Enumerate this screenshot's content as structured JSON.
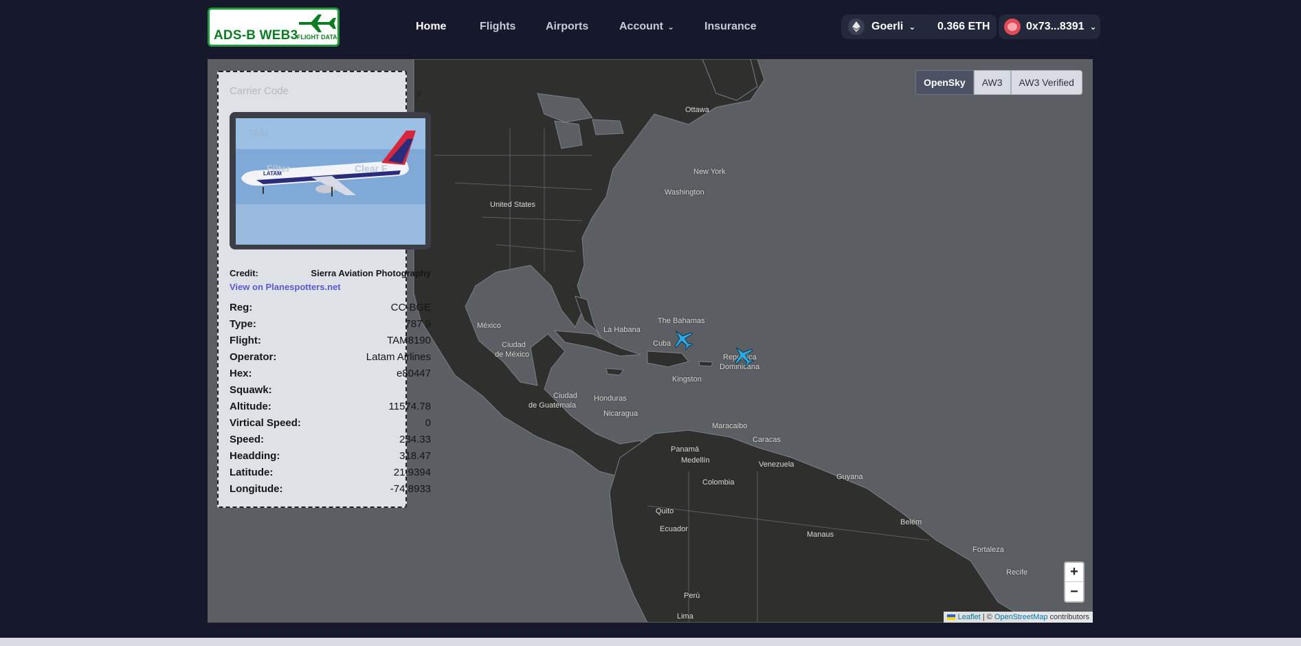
{
  "header": {
    "logo_text": "ADS-B WEB3",
    "logo_sub": "FLIGHT DATA",
    "nav": [
      {
        "label": "Home",
        "active": true
      },
      {
        "label": "Flights",
        "active": false
      },
      {
        "label": "Airports",
        "active": false
      },
      {
        "label": "Account",
        "active": false
      },
      {
        "label": "Insurance",
        "active": false
      }
    ],
    "network": "Goerli",
    "balance": "0.366 ETH",
    "account": "0x73...8391"
  },
  "map": {
    "layers": [
      {
        "label": "OpenSky",
        "active": true
      },
      {
        "label": "AW3",
        "active": false
      },
      {
        "label": "AW3 Verified",
        "active": false
      }
    ],
    "labels": {
      "ottawa": "Ottawa",
      "new_york": "New York",
      "washington": "Washington",
      "united_states": "United States",
      "mexico": "México",
      "ciudad_de_mexico_1": "Ciudad",
      "ciudad_de_mexico_2": "de México",
      "la_habana": "La Habana",
      "bahamas": "The Bahamas",
      "cuba": "Cuba",
      "republica": "República",
      "dominicana": "Dominicana",
      "kingston": "Kingston",
      "guatemala_1": "Ciudad",
      "guatemala_2": "de Guatemala",
      "honduras": "Honduras",
      "nicaragua": "Nicaragua",
      "panama": "Panamá",
      "maracaibo": "Maracaibo",
      "caracas": "Caracas",
      "medellin": "Medellín",
      "venezuela": "Venezuela",
      "guyana": "Guyana",
      "colombia": "Colombia",
      "quito": "Quito",
      "ecuador": "Ecuador",
      "belem": "Belém",
      "manaus": "Manaus",
      "fortaleza": "Fortaleza",
      "recife": "Recife",
      "peru": "Perú",
      "lima": "Lima"
    },
    "zoom_in": "+",
    "zoom_out": "−",
    "attribution": {
      "leaflet": "Leaflet",
      "sep": " | © ",
      "osm": "OpenStreetMap",
      "contributors": " contributors"
    }
  },
  "panel": {
    "ghost_carrier_label": "Carrier Code",
    "ghost_carrier_value": "TAM",
    "ghost_filter": "Filter",
    "ghost_clear": "Clear F",
    "close": "×",
    "credit_label": "Credit:",
    "credit_value": "Sierra Aviation Photography",
    "planespotters_link": "View on Planespotters.net",
    "fields": [
      {
        "label": "Reg:",
        "value": "CC-BGE"
      },
      {
        "label": "Type:",
        "value": "787 9"
      },
      {
        "label": "Flight:",
        "value": "TAM8190"
      },
      {
        "label": "Operator:",
        "value": "Latam Airlines"
      },
      {
        "label": "Hex:",
        "value": "e80447"
      },
      {
        "label": "Squawk:",
        "value": ""
      },
      {
        "label": "Altitude:",
        "value": "11574.78"
      },
      {
        "label": "Virtical Speed:",
        "value": "0"
      },
      {
        "label": "Speed:",
        "value": "234.33"
      },
      {
        "label": "Headding:",
        "value": "318.47"
      },
      {
        "label": "Latitude:",
        "value": "21.9394"
      },
      {
        "label": "Longitude:",
        "value": "-74.8933"
      }
    ]
  },
  "colors": {
    "background": "#15192b",
    "map_sea": "#5b5f63",
    "map_land": "#2f302e",
    "plane": "#2fa8e0",
    "logo_green": "#0c7d23"
  }
}
